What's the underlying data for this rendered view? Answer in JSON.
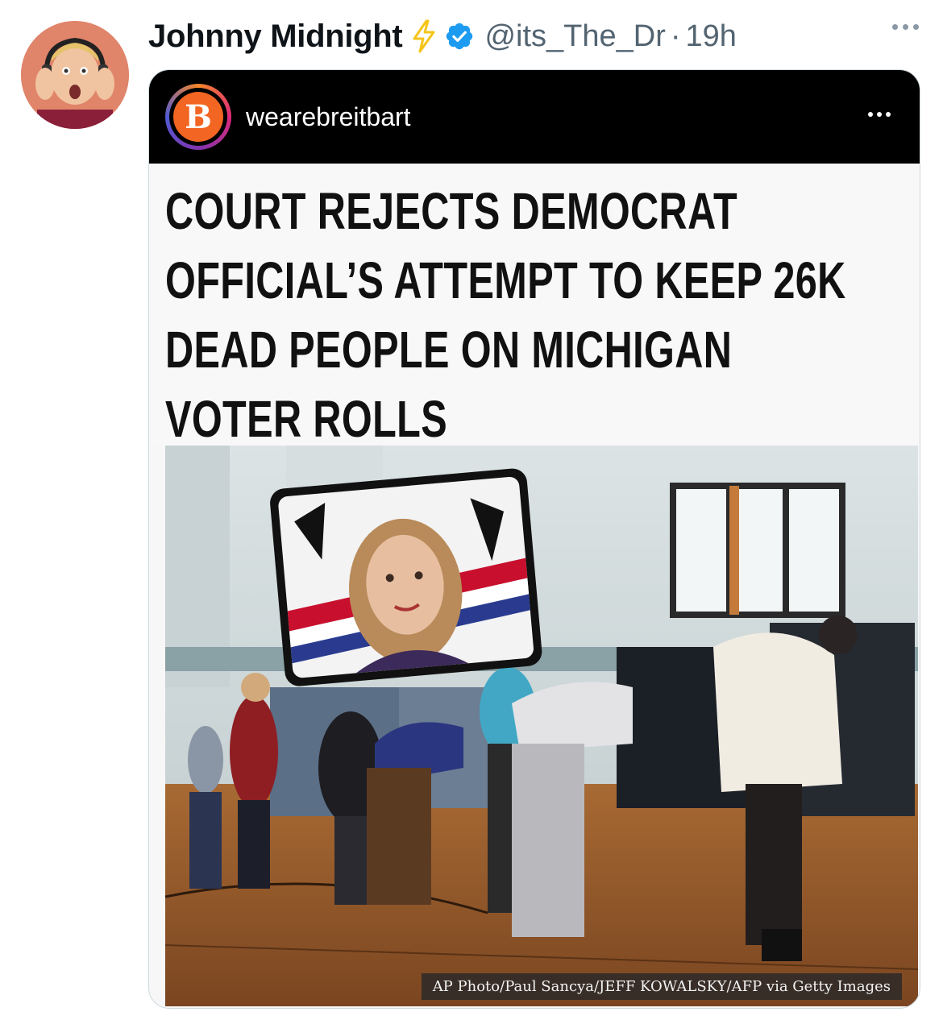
{
  "tweet": {
    "author": {
      "display_name": "Johnny Midnight",
      "handle": "@its_The_Dr",
      "separator": "·",
      "time": "19h",
      "verified": true,
      "badge_icon": "lightning-bolt-icon"
    },
    "more_icon": "more-horizontal-icon"
  },
  "embedded_post": {
    "platform_header": {
      "logo_letter": "B",
      "account": "wearebreitbart",
      "more_icon": "more-horizontal-icon"
    },
    "headline_lines": [
      "COURT REJECTS DEMOCRAT",
      "OFFICIAL’S ATTEMPT TO KEEP 26K",
      "DEAD PEOPLE ON MICHIGAN",
      "VOTER ROLLS"
    ],
    "photo_caption": "AP Photo/Paul Sancya/JEFF KOWALSKY/AFP via Getty Images"
  },
  "colors": {
    "verified_blue": "#1d9bf0",
    "bolt_yellow": "#f5c518",
    "breitbart_orange": "#f26522",
    "muted_text": "#536471"
  }
}
